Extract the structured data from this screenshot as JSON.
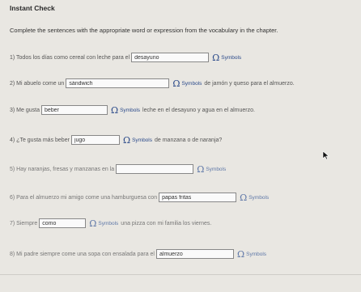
{
  "header": {
    "title": "Instant Check"
  },
  "instructions": "Complete the sentences with the appropriate word or expression from the vocabulary in the chapter.",
  "symbols_label": "Symbols",
  "items": [
    {
      "before": "1) Todos los días como cereal con leche para el",
      "value": "desayuno",
      "after": ""
    },
    {
      "before": "2) Mi abuelo come un",
      "value": "sándwich",
      "after": "de jamón y queso para el almuerzo."
    },
    {
      "before": "3) Me gusta",
      "value": "beber",
      "after": "leche en el desayuno y agua en el almuerzo."
    },
    {
      "before": "4) ¿Te gusta más beber",
      "value": "jugo",
      "after": "de manzana o de naranja?"
    },
    {
      "before": "5) Hay naranjas, fresas y manzanas en la",
      "value": "",
      "after": ""
    },
    {
      "before": "6) Para el almuerzo mi amigo come una hamburguesa con",
      "value": "papas fritas",
      "after": ""
    },
    {
      "before": "7) Siempre",
      "value": "como",
      "after": "una pizza con mi familia los viernes."
    },
    {
      "before": "8) Mi padre siempre come una sopa con ensalada para el",
      "value": "almuerzo",
      "after": ""
    }
  ]
}
